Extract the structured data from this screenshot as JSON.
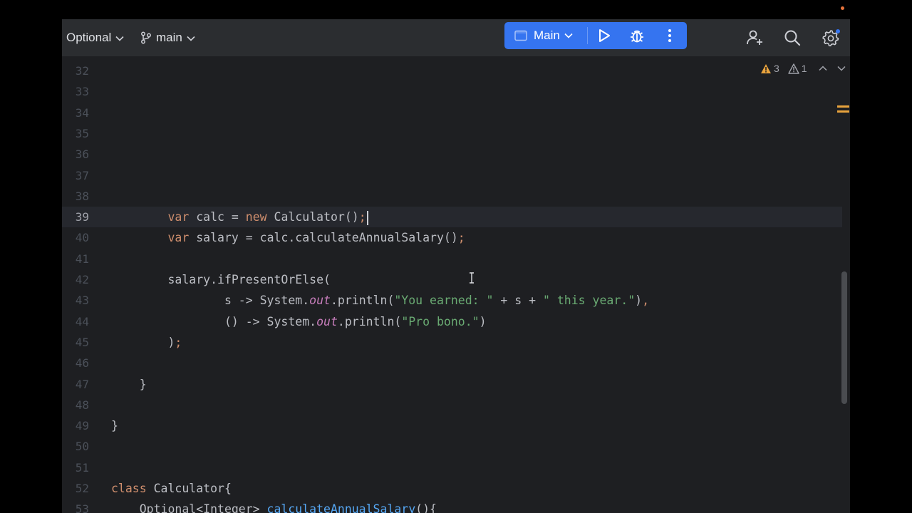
{
  "toolbar": {
    "project_widget": "Optional",
    "vcs_branch": "main",
    "run_config": "Main",
    "icons": [
      "chevron-down-icon",
      "branch-icon",
      "run-icon",
      "debug-icon",
      "more-vertical-icon",
      "add-user-icon",
      "search-icon",
      "gear-icon"
    ]
  },
  "inspections": {
    "warnings": "3",
    "weak_warnings": "1"
  },
  "editor": {
    "current_line": "39",
    "lines": [
      {
        "num": "32",
        "code": ""
      },
      {
        "num": "33",
        "code": ""
      },
      {
        "num": "34",
        "code": ""
      },
      {
        "num": "35",
        "code": ""
      },
      {
        "num": "36",
        "code": ""
      },
      {
        "num": "37",
        "code": ""
      },
      {
        "num": "38",
        "code": ""
      },
      {
        "num": "39",
        "code": "        var calc = new Calculator();"
      },
      {
        "num": "40",
        "code": "        var salary = calc.calculateAnnualSalary();"
      },
      {
        "num": "41",
        "code": ""
      },
      {
        "num": "42",
        "code": "        salary.ifPresentOrElse("
      },
      {
        "num": "43",
        "code": "                s -> System.out.println(\"You earned: \" + s + \" this year.\"),"
      },
      {
        "num": "44",
        "code": "                () -> System.out.println(\"Pro bono.\")"
      },
      {
        "num": "45",
        "code": "        );"
      },
      {
        "num": "46",
        "code": ""
      },
      {
        "num": "47",
        "code": "    }"
      },
      {
        "num": "48",
        "code": ""
      },
      {
        "num": "49",
        "code": "}"
      },
      {
        "num": "50",
        "code": ""
      },
      {
        "num": "51",
        "code": ""
      },
      {
        "num": "52",
        "code": "class Calculator{"
      },
      {
        "num": "53",
        "code": "    Optional<Integer> calculateAnnualSalary(){"
      }
    ]
  },
  "colors": {
    "accent": "#3574f0",
    "keyword": "#cf8e6d",
    "string": "#6aab73",
    "static_field": "#c77dbb",
    "method_decl": "#56a8f5",
    "warning": "#e8a33d"
  }
}
